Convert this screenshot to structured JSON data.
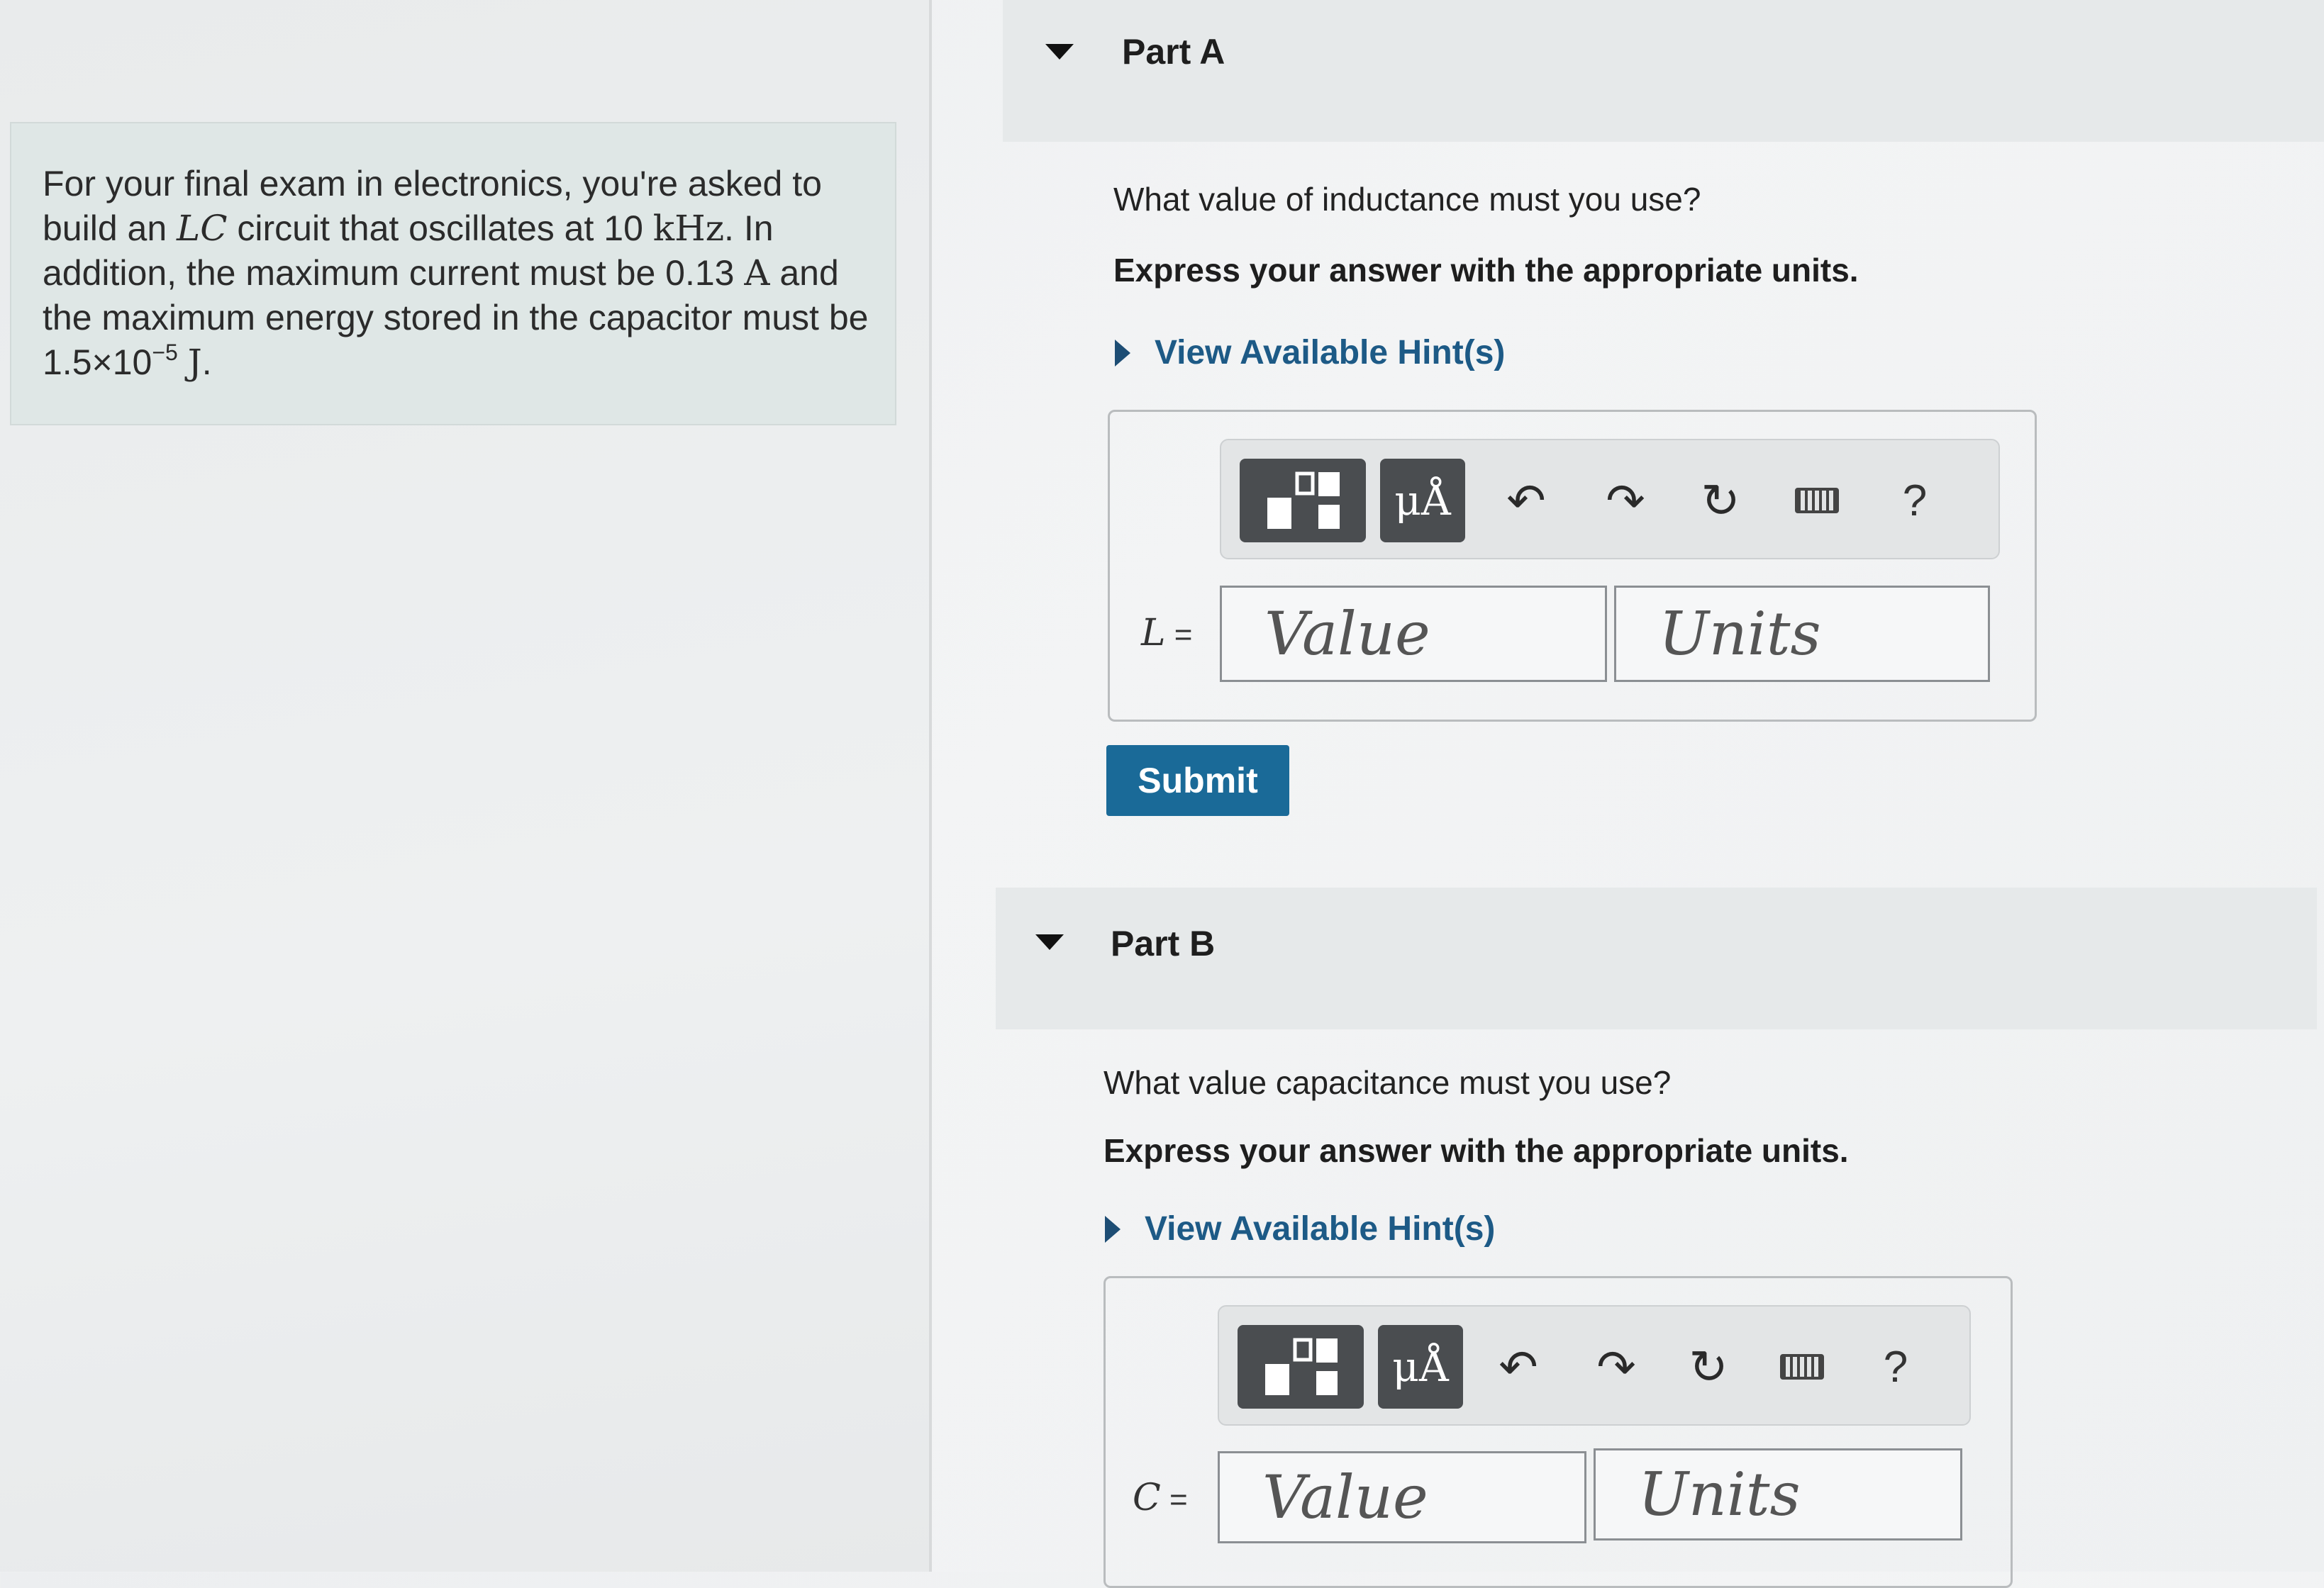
{
  "problem": {
    "t1": "For your final exam in electronics, you're asked to build an ",
    "lc": "LC",
    "t2": " circuit that oscillates at 10 ",
    "khz": "kHz",
    "t3": ". In addition, the maximum current must be 0.13 ",
    "amp": "A",
    "t4": " and the maximum energy stored in the capacitor must be 1.5×10",
    "exp": "−5",
    "joule": "J",
    "t5": "."
  },
  "toolbar": {
    "units_label": "μÅ",
    "undo_glyph": "↶",
    "redo_glyph": "↷",
    "reset_glyph": "↻",
    "help_label": "?",
    "icons": [
      "templates-icon",
      "units-icon",
      "undo-icon",
      "redo-icon",
      "reset-icon",
      "keyboard-icon",
      "help-icon"
    ]
  },
  "partA": {
    "title": "Part A",
    "question": "What value of inductance must you use?",
    "instruction": "Express your answer with the appropriate units.",
    "hint_label": "View Available Hint(s)",
    "var_name": "L",
    "equals": " =",
    "value_placeholder": "Value",
    "units_placeholder": "Units",
    "submit_label": "Submit"
  },
  "partB": {
    "title": "Part B",
    "question": "What value capacitance must you use?",
    "instruction": "Express your answer with the appropriate units.",
    "hint_label": "View Available Hint(s)",
    "var_name": "C",
    "equals": " =",
    "value_placeholder": "Value",
    "units_placeholder": "Units"
  },
  "colors": {
    "submit": "#1a6a98",
    "hint_link": "#1d5a86",
    "toolbar_button": "#4a4d50",
    "problem_box": "#dfe7e6"
  }
}
